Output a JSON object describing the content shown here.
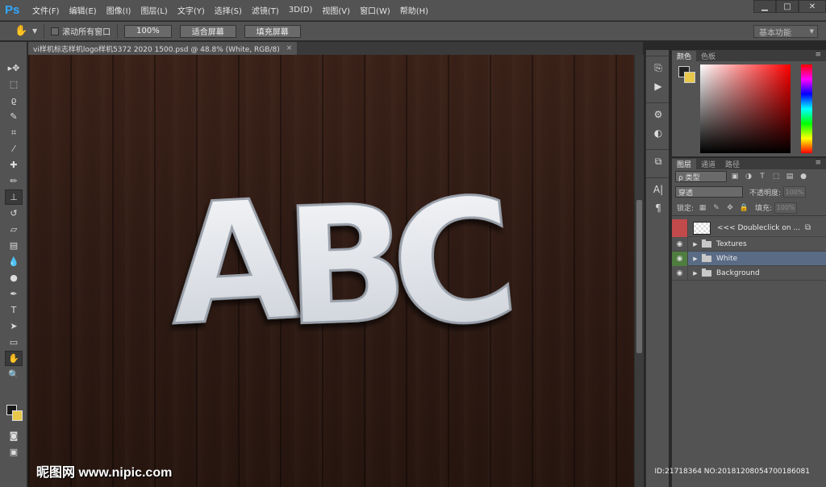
{
  "app": {
    "logo": "Ps",
    "menus": [
      "文件(F)",
      "编辑(E)",
      "图像(I)",
      "图层(L)",
      "文字(Y)",
      "选择(S)",
      "滤镜(T)",
      "3D(D)",
      "视图(V)",
      "窗口(W)",
      "帮助(H)"
    ],
    "window_controls": {
      "minimize": "▁",
      "maximize": "□",
      "close": "✕"
    }
  },
  "options": {
    "scroll_all_label": "滚动所有窗口",
    "zoom_100": "100%",
    "fit_screen": "适合屏幕",
    "fill_screen": "填充屏幕",
    "workspace": "基本功能"
  },
  "document": {
    "tab_title": "vi样机标志样机logo样机5372 2020 1500.psd @ 48.8% (White, RGB/8)",
    "close": "×",
    "artwork_text": [
      "A",
      "B",
      "C"
    ]
  },
  "watermark": {
    "text": "昵图网 www.nipic.com",
    "id_text": "ID:21718364 NO:20181208054700186081"
  },
  "color_panel": {
    "tabs": [
      "颜色",
      "色板"
    ]
  },
  "layers_panel": {
    "tabs": [
      "图层",
      "通道",
      "路径"
    ],
    "filter": "ρ 类型",
    "blend_mode": "穿透",
    "opacity_label": "不透明度:",
    "opacity_value": "100%",
    "lock_label": "锁定:",
    "fill_label": "填充:",
    "fill_value": "100%",
    "layers": [
      {
        "name": "<<< Doubleclick on ...",
        "type": "smart"
      },
      {
        "name": "Textures",
        "type": "group"
      },
      {
        "name": "White",
        "type": "group",
        "selected": true
      },
      {
        "name": "Background",
        "type": "group"
      }
    ]
  },
  "colors": {
    "accent": "#31a8ff",
    "selection": "#5a6b85",
    "wood": "#2f1b14",
    "fg_swatch": "#1a1a1a",
    "bg_swatch": "#e8c84a"
  }
}
